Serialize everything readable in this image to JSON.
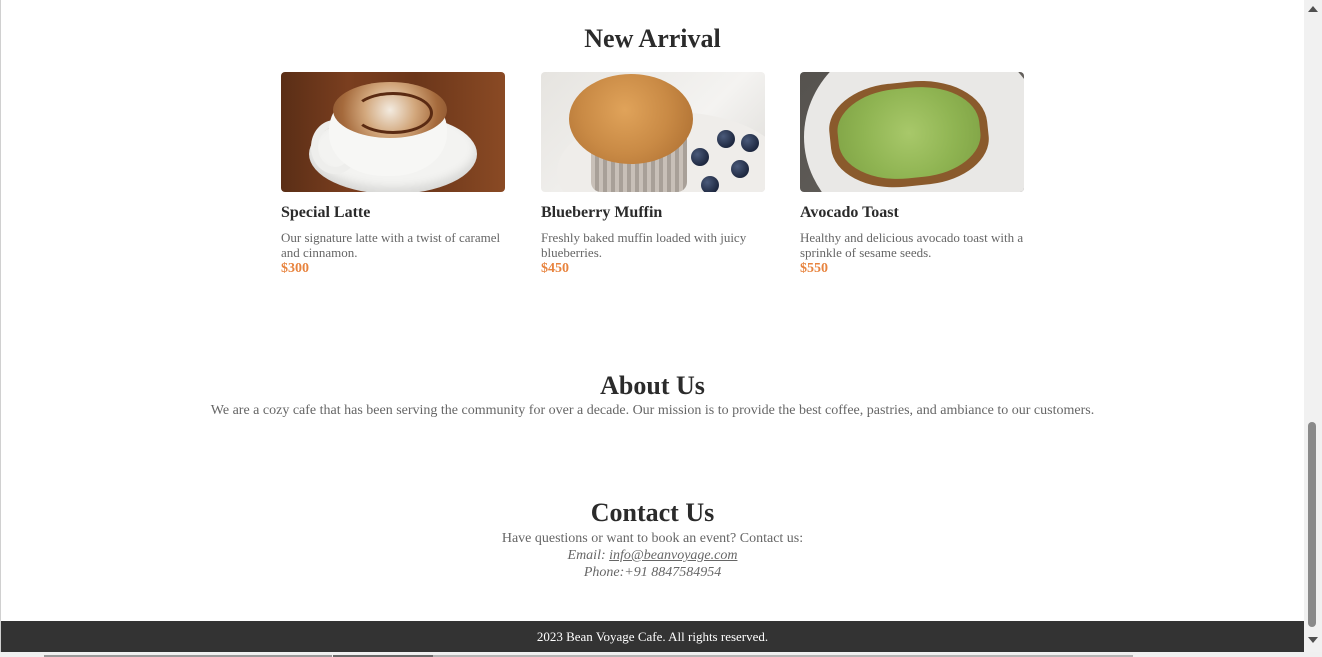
{
  "new_arrival": {
    "title": "New Arrival",
    "items": [
      {
        "name": "Special Latte",
        "desc": "Our signature latte with a twist of caramel and cinnamon.",
        "price": "$300"
      },
      {
        "name": "Blueberry Muffin",
        "desc": "Freshly baked muffin loaded with juicy blueberries.",
        "price": "$450"
      },
      {
        "name": "Avocado Toast",
        "desc": "Healthy and delicious avocado toast with a sprinkle of sesame seeds.",
        "price": "$550"
      }
    ]
  },
  "about": {
    "title": "About Us",
    "text": "We are a cozy cafe that has been serving the community for over a decade. Our mission is to provide the best coffee, pastries, and ambiance to our customers."
  },
  "contact": {
    "title": "Contact Us",
    "intro": "Have questions or want to book an event? Contact us:",
    "email_label": "Email: ",
    "email": "info@beanvoyage.com",
    "phone": "Phone:+91 8847584954"
  },
  "footer": {
    "text": "2023 Bean Voyage Cafe. All rights reserved."
  },
  "colors": {
    "price": "#e8843f",
    "footer_bg": "#333333",
    "heading": "#2b2b2b",
    "body_text": "#666666"
  }
}
